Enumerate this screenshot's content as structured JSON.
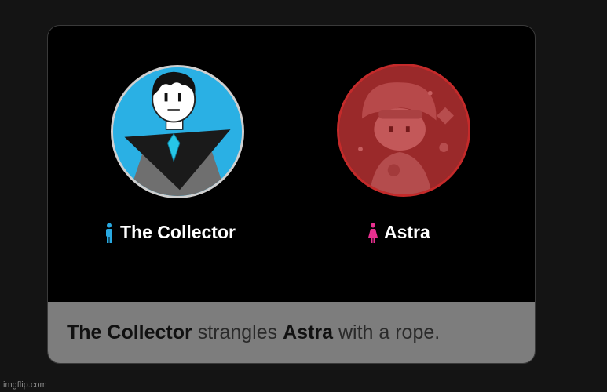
{
  "tributes": [
    {
      "name": "The Collector",
      "gender_icon": "male-icon",
      "gender_color": "#29a9e1",
      "status": "alive",
      "ring_color": "#cfcfcf"
    },
    {
      "name": "Astra",
      "gender_icon": "female-icon",
      "gender_color": "#e8308f",
      "status": "dead",
      "ring_color": "#c42a2a"
    }
  ],
  "event": {
    "actor": "The Collector",
    "verb": " strangles ",
    "target": "Astra",
    "rest": " with a rope."
  },
  "watermark": "imgflip.com"
}
